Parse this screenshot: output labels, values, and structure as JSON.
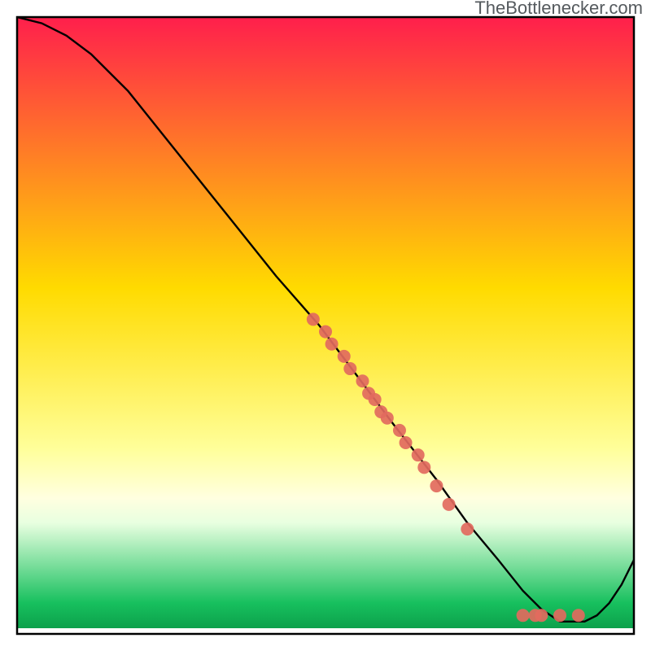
{
  "watermark": "TheBottlenecker.com",
  "chart_data": {
    "type": "line",
    "title": "",
    "xlabel": "",
    "ylabel": "",
    "xlim": [
      0,
      100
    ],
    "ylim": [
      0,
      100
    ],
    "background": {
      "gradient_top": "#ff1f4c",
      "gradient_mid_upper": "#ffdb00",
      "gradient_mid_lower": "#ffff9a",
      "gradient_lower_green_light": "#a7f0a7",
      "gradient_green": "#17c05e",
      "gradient_bottom_fill": "#ffffff"
    },
    "curve": {
      "name": "bottleneck-curve",
      "x": [
        0,
        4,
        8,
        12,
        18,
        26,
        34,
        42,
        49,
        55,
        61,
        68,
        73,
        78,
        82,
        85,
        88,
        90,
        92,
        94,
        96,
        98,
        100
      ],
      "y": [
        100,
        99,
        97,
        94,
        88,
        78,
        68,
        58,
        50,
        42,
        34,
        25,
        18,
        12,
        7,
        4,
        2,
        2,
        2,
        3,
        5,
        8,
        12
      ]
    },
    "scatter_cluster_a": {
      "name": "diagonal-points",
      "color": "#e26a5e",
      "points": [
        {
          "x": 48,
          "y": 51
        },
        {
          "x": 50,
          "y": 49
        },
        {
          "x": 51,
          "y": 47
        },
        {
          "x": 53,
          "y": 45
        },
        {
          "x": 54,
          "y": 43
        },
        {
          "x": 56,
          "y": 41
        },
        {
          "x": 57,
          "y": 39
        },
        {
          "x": 58,
          "y": 38
        },
        {
          "x": 59,
          "y": 36
        },
        {
          "x": 60,
          "y": 35
        },
        {
          "x": 62,
          "y": 33
        },
        {
          "x": 63,
          "y": 31
        },
        {
          "x": 65,
          "y": 29
        },
        {
          "x": 66,
          "y": 27
        },
        {
          "x": 68,
          "y": 24
        },
        {
          "x": 70,
          "y": 21
        },
        {
          "x": 73,
          "y": 17
        }
      ]
    },
    "scatter_cluster_b": {
      "name": "bottom-points",
      "color": "#e26a5e",
      "points": [
        {
          "x": 82,
          "y": 3
        },
        {
          "x": 84,
          "y": 3
        },
        {
          "x": 85,
          "y": 3
        },
        {
          "x": 88,
          "y": 3
        },
        {
          "x": 91,
          "y": 3
        }
      ]
    },
    "frame_color": "#000000",
    "curve_color": "#000000"
  }
}
